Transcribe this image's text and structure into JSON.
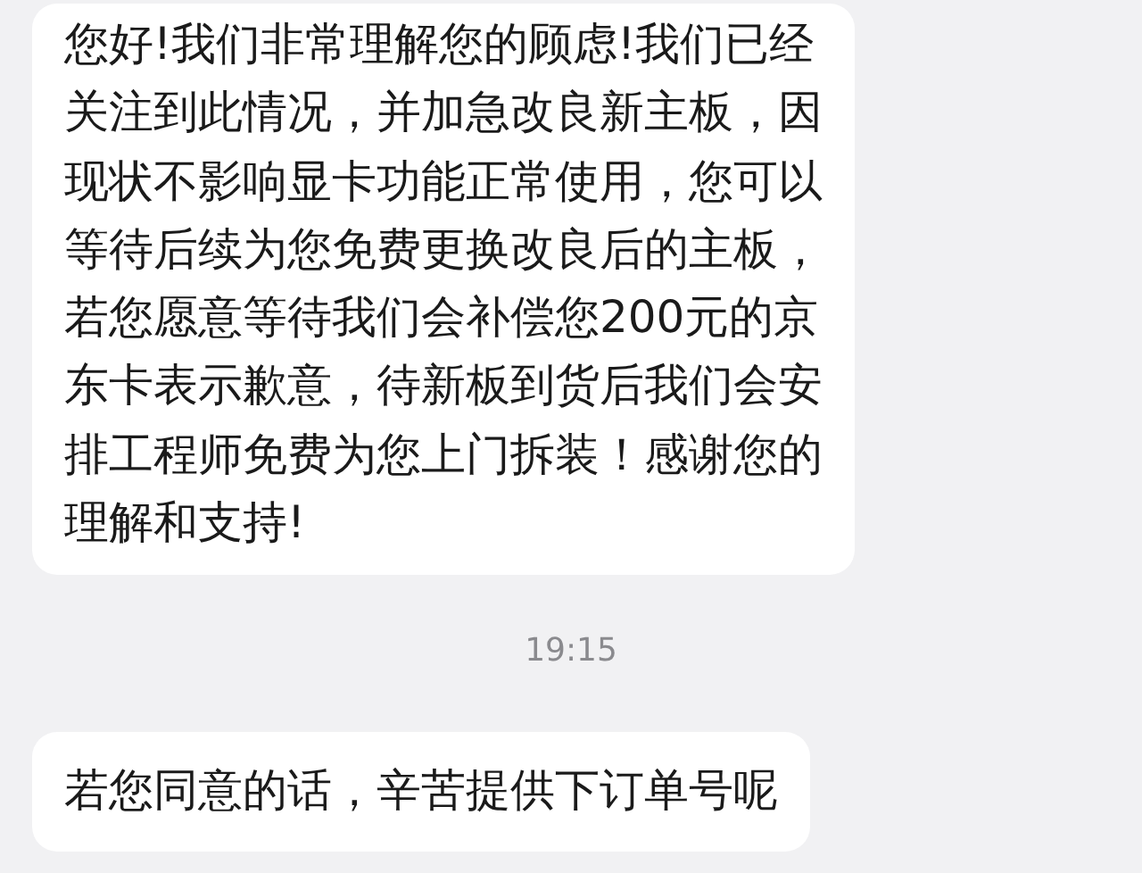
{
  "messages": [
    {
      "kind": "bubble",
      "lines": [
        "您好!我们非常理解您的顾虑!我们已经",
        "关注到此情况，并加急改良新主板，因",
        "现状不影响显卡功能正常使用，您可以",
        "等待后续为您免费更换改良后的主板，",
        "若您愿意等待我们会补偿您200元的京",
        "东卡表示歉意，待新板到货后我们会安",
        "排工程师免费为您上门拆装！感谢您的",
        "理解和支持!"
      ]
    },
    {
      "kind": "time",
      "text": "19:15"
    },
    {
      "kind": "bubble",
      "lines": [
        "若您同意的话，辛苦提供下订单号呢"
      ]
    }
  ]
}
